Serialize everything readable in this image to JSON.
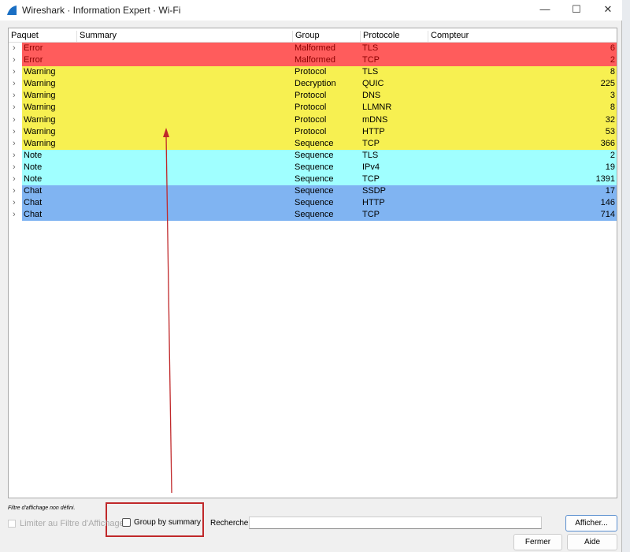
{
  "window": {
    "title": "Wireshark · Information Expert · Wi-Fi",
    "minimize": "—",
    "maximize": "☐",
    "close": "✕"
  },
  "columns": [
    "Paquet",
    "Summary",
    "Group",
    "Protocole",
    "Compteur"
  ],
  "colors": {
    "Error": "#ff5c5c",
    "Warning": "#f7f051",
    "Note": "#a0ffff",
    "Chat": "#80b4f2"
  },
  "rows": [
    {
      "severity": "Error",
      "group": "Malformed",
      "protocol": "TLS",
      "count": "6"
    },
    {
      "severity": "Error",
      "group": "Malformed",
      "protocol": "TCP",
      "count": "2"
    },
    {
      "severity": "Warning",
      "group": "Protocol",
      "protocol": "TLS",
      "count": "8"
    },
    {
      "severity": "Warning",
      "group": "Decryption",
      "protocol": "QUIC",
      "count": "225"
    },
    {
      "severity": "Warning",
      "group": "Protocol",
      "protocol": "DNS",
      "count": "3"
    },
    {
      "severity": "Warning",
      "group": "Protocol",
      "protocol": "LLMNR",
      "count": "8"
    },
    {
      "severity": "Warning",
      "group": "Protocol",
      "protocol": "mDNS",
      "count": "32"
    },
    {
      "severity": "Warning",
      "group": "Protocol",
      "protocol": "HTTP",
      "count": "53"
    },
    {
      "severity": "Warning",
      "group": "Sequence",
      "protocol": "TCP",
      "count": "366"
    },
    {
      "severity": "Note",
      "group": "Sequence",
      "protocol": "TLS",
      "count": "2"
    },
    {
      "severity": "Note",
      "group": "Sequence",
      "protocol": "IPv4",
      "count": "19"
    },
    {
      "severity": "Note",
      "group": "Sequence",
      "protocol": "TCP",
      "count": "1391"
    },
    {
      "severity": "Chat",
      "group": "Sequence",
      "protocol": "SSDP",
      "count": "17"
    },
    {
      "severity": "Chat",
      "group": "Sequence",
      "protocol": "HTTP",
      "count": "146"
    },
    {
      "severity": "Chat",
      "group": "Sequence",
      "protocol": "TCP",
      "count": "714"
    }
  ],
  "footer": {
    "filter_status": "Filtre d'affichage non défini.",
    "limit_label": "Limiter au Filtre d'Affichage",
    "group_label": "Group by summary",
    "search_label": "Recherche:",
    "search_value": "",
    "show_button": "Afficher...",
    "close_button": "Fermer",
    "help_button": "Aide"
  }
}
